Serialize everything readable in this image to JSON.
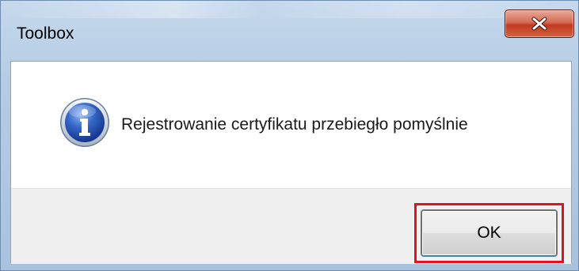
{
  "dialog": {
    "title": "Toolbox",
    "message": "Rejestrowanie certyfikatu przebiegło pomyślnie",
    "icon": "info-icon",
    "ok_label": "OK",
    "close_icon": "close-icon"
  },
  "colors": {
    "highlight_border": "#e0141e",
    "close_button": "#c03a20",
    "footer_background": "#f0f0f0"
  }
}
